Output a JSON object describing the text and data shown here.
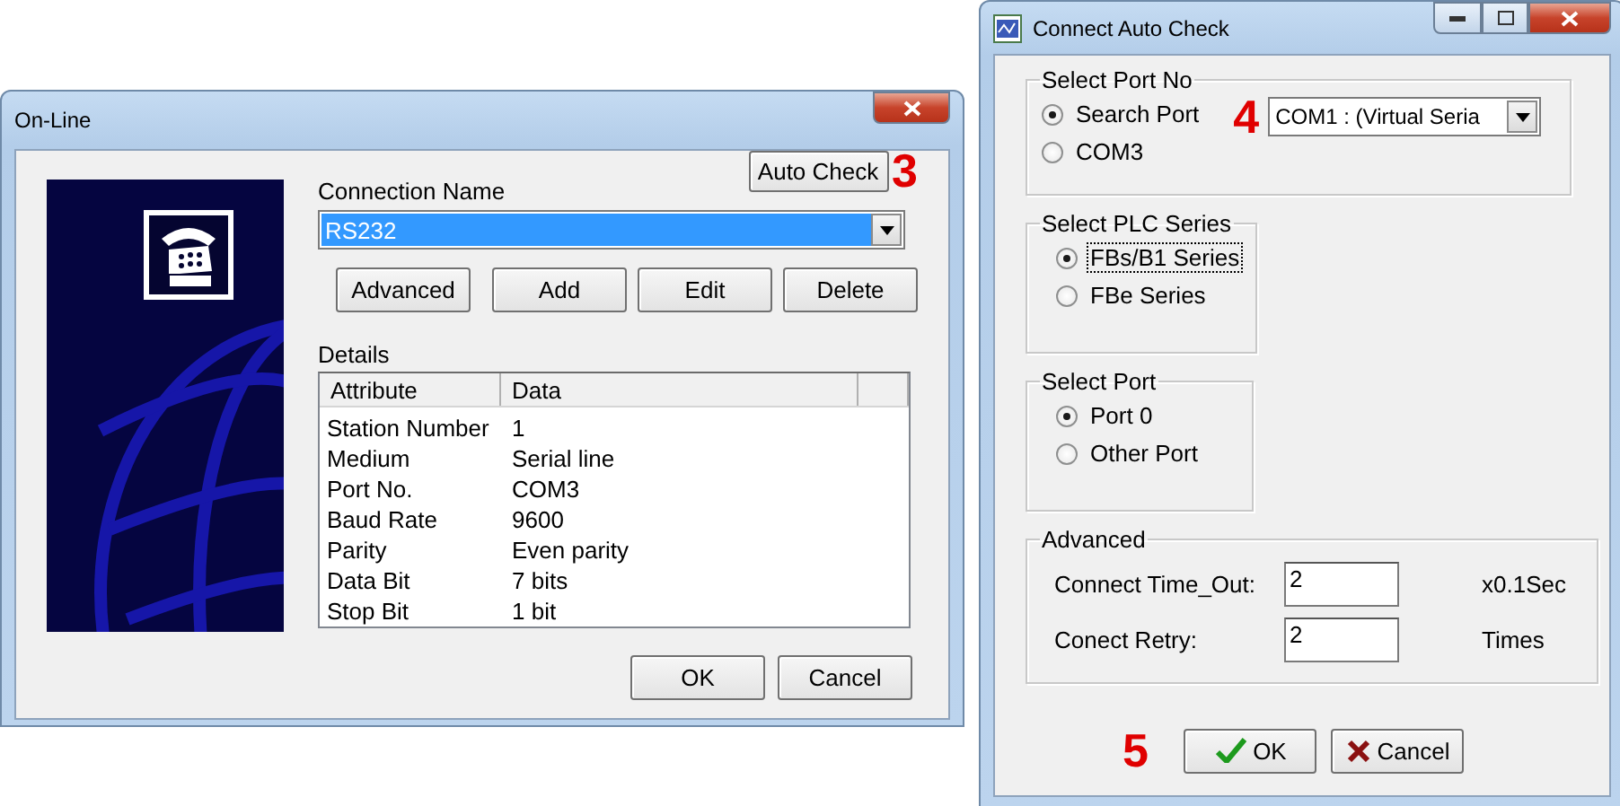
{
  "online_window": {
    "title": "On-Line",
    "auto_check_button": "Auto Check",
    "callout": "3",
    "connection_name_label": "Connection Name",
    "connection_select": {
      "value": "RS232"
    },
    "buttons": [
      "Advanced",
      "Add",
      "Edit",
      "Delete"
    ],
    "details_label": "Details",
    "table": {
      "columns": [
        "Attribute",
        "Data"
      ],
      "rows": [
        {
          "attribute": "Station Number",
          "data": "1"
        },
        {
          "attribute": "Medium",
          "data": "Serial line"
        },
        {
          "attribute": "Port No.",
          "data": "COM3"
        },
        {
          "attribute": "Baud Rate",
          "data": "9600"
        },
        {
          "attribute": "Parity",
          "data": "Even parity"
        },
        {
          "attribute": "Data Bit",
          "data": "7 bits"
        },
        {
          "attribute": "Stop Bit",
          "data": "1 bit"
        }
      ]
    },
    "footer_buttons": [
      "OK",
      "Cancel"
    ]
  },
  "auto_check_window": {
    "title": "Connect Auto Check",
    "port_no_group": {
      "title": "Select Port No",
      "options": [
        {
          "label": "Search Port",
          "selected": true,
          "focused": false
        },
        {
          "label": "COM3",
          "selected": false,
          "focused": false
        }
      ],
      "callout": "4",
      "port_select": {
        "value": "COM1 : (Virtual Seria"
      }
    },
    "plc_series_group": {
      "title": "Select PLC Series",
      "options": [
        {
          "label": "FBs/B1 Series",
          "selected": true,
          "focused": true
        },
        {
          "label": "FBe Series",
          "selected": false,
          "focused": false
        }
      ]
    },
    "port_group": {
      "title": "Select Port",
      "options": [
        {
          "label": "Port 0",
          "selected": true,
          "focused": false
        },
        {
          "label": "Other Port",
          "selected": false,
          "focused": false
        }
      ]
    },
    "advanced_group": {
      "title": "Advanced",
      "fields": [
        {
          "label": "Connect Time_Out:",
          "value": "2",
          "unit": "x0.1Sec"
        },
        {
          "label": "Conect Retry:",
          "value": "2",
          "unit": "Times"
        }
      ]
    },
    "callout": "5",
    "buttons": [
      {
        "label": "OK",
        "kind": "ok"
      },
      {
        "label": "Cancel",
        "kind": "cancel"
      }
    ]
  }
}
